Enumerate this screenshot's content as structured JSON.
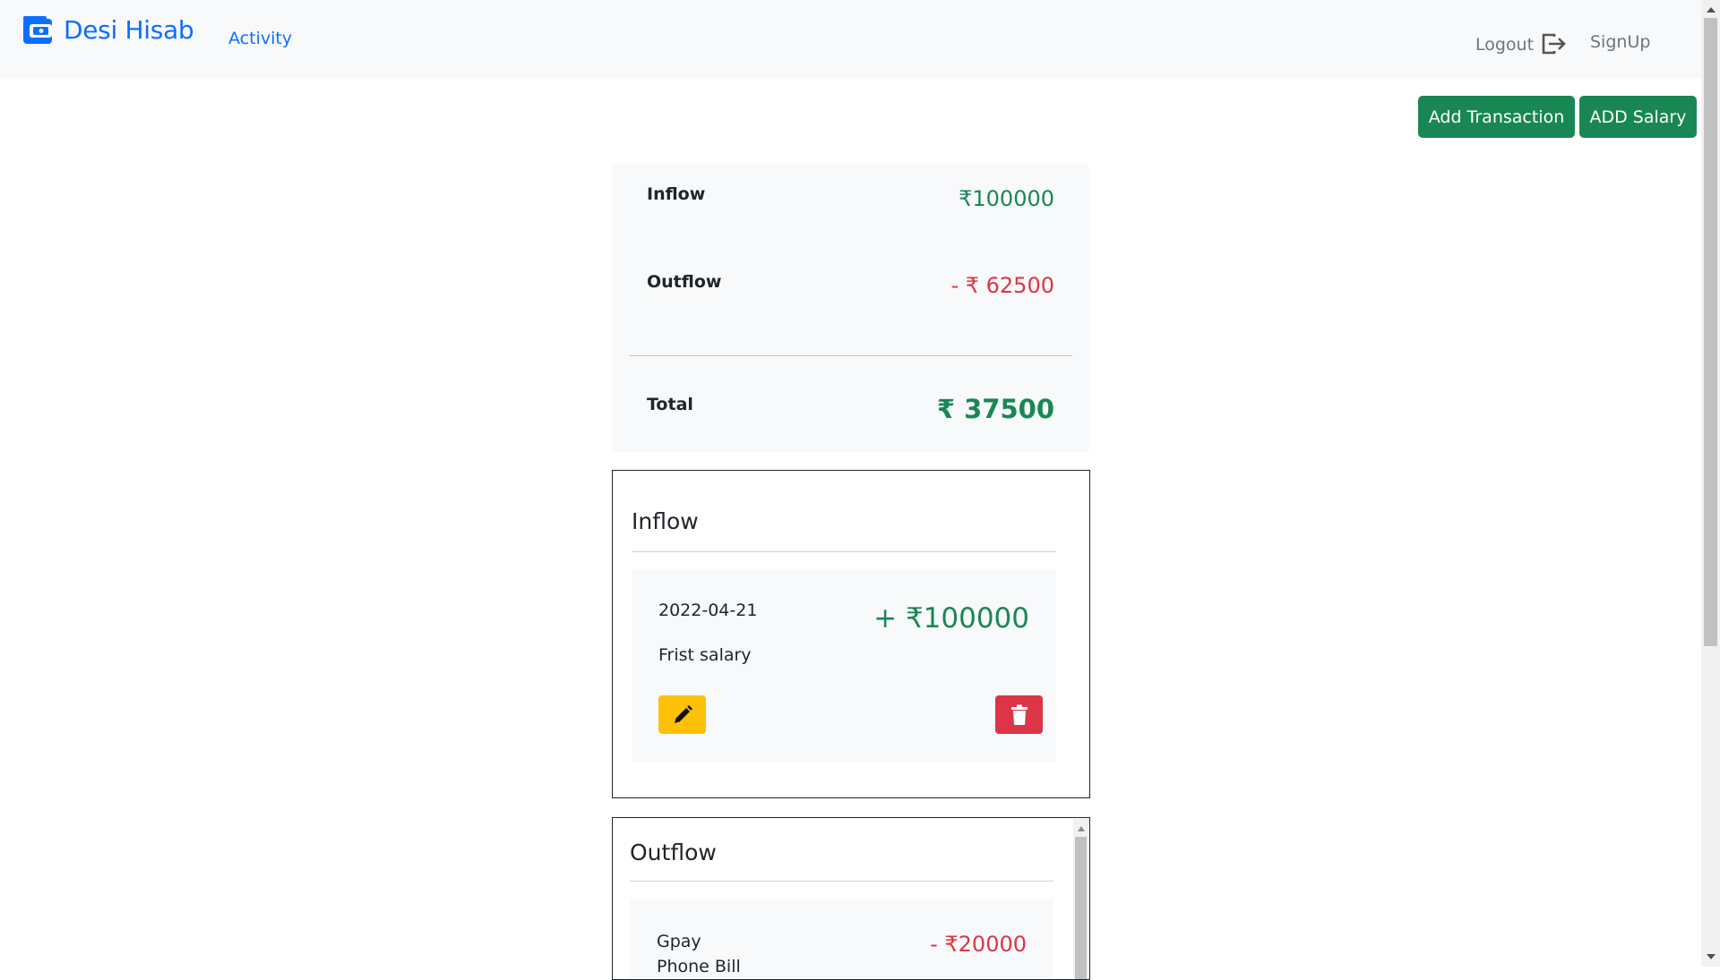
{
  "navbar": {
    "brand": "Desi Hisab",
    "activity": "Activity",
    "logout": "Logout",
    "signup": "SignUp"
  },
  "actions": {
    "add_transaction": "Add Transaction",
    "add_salary": "ADD Salary"
  },
  "summary": {
    "inflow_label": "Inflow",
    "inflow_value": "₹100000",
    "outflow_label": "Outflow",
    "outflow_value": "- ₹ 62500",
    "total_label": "Total",
    "total_value": "₹ 37500"
  },
  "inflow_section": {
    "title": "Inflow",
    "items": [
      {
        "date": "2022-04-21",
        "amount": "+ ₹100000",
        "note": "Frist salary"
      }
    ]
  },
  "outflow_section": {
    "title": "Outflow",
    "items": [
      {
        "name": "Gpay",
        "note": "Phone Bill",
        "amount": "- ₹20000"
      }
    ]
  },
  "colors": {
    "brand_blue": "#0d6efd",
    "success_green": "#198754",
    "danger_red": "#dc3545",
    "warning_yellow": "#ffc107",
    "light_bg": "#f8f9fa"
  },
  "icons": [
    "wallet-icon",
    "logout-icon",
    "pencil-icon",
    "trash-icon"
  ]
}
